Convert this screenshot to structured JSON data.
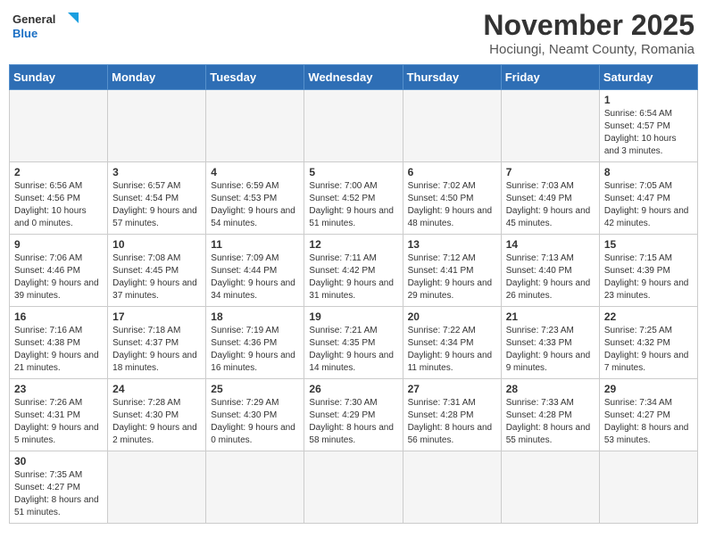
{
  "header": {
    "logo_general": "General",
    "logo_blue": "Blue",
    "month_year": "November 2025",
    "location": "Hociungi, Neamt County, Romania"
  },
  "days_of_week": [
    "Sunday",
    "Monday",
    "Tuesday",
    "Wednesday",
    "Thursday",
    "Friday",
    "Saturday"
  ],
  "weeks": [
    [
      {
        "day": "",
        "empty": true
      },
      {
        "day": "",
        "empty": true
      },
      {
        "day": "",
        "empty": true
      },
      {
        "day": "",
        "empty": true
      },
      {
        "day": "",
        "empty": true
      },
      {
        "day": "",
        "empty": true
      },
      {
        "day": "1",
        "info": "Sunrise: 6:54 AM\nSunset: 4:57 PM\nDaylight: 10 hours and 3 minutes."
      }
    ],
    [
      {
        "day": "2",
        "info": "Sunrise: 6:56 AM\nSunset: 4:56 PM\nDaylight: 10 hours and 0 minutes."
      },
      {
        "day": "3",
        "info": "Sunrise: 6:57 AM\nSunset: 4:54 PM\nDaylight: 9 hours and 57 minutes."
      },
      {
        "day": "4",
        "info": "Sunrise: 6:59 AM\nSunset: 4:53 PM\nDaylight: 9 hours and 54 minutes."
      },
      {
        "day": "5",
        "info": "Sunrise: 7:00 AM\nSunset: 4:52 PM\nDaylight: 9 hours and 51 minutes."
      },
      {
        "day": "6",
        "info": "Sunrise: 7:02 AM\nSunset: 4:50 PM\nDaylight: 9 hours and 48 minutes."
      },
      {
        "day": "7",
        "info": "Sunrise: 7:03 AM\nSunset: 4:49 PM\nDaylight: 9 hours and 45 minutes."
      },
      {
        "day": "8",
        "info": "Sunrise: 7:05 AM\nSunset: 4:47 PM\nDaylight: 9 hours and 42 minutes."
      }
    ],
    [
      {
        "day": "9",
        "info": "Sunrise: 7:06 AM\nSunset: 4:46 PM\nDaylight: 9 hours and 39 minutes."
      },
      {
        "day": "10",
        "info": "Sunrise: 7:08 AM\nSunset: 4:45 PM\nDaylight: 9 hours and 37 minutes."
      },
      {
        "day": "11",
        "info": "Sunrise: 7:09 AM\nSunset: 4:44 PM\nDaylight: 9 hours and 34 minutes."
      },
      {
        "day": "12",
        "info": "Sunrise: 7:11 AM\nSunset: 4:42 PM\nDaylight: 9 hours and 31 minutes."
      },
      {
        "day": "13",
        "info": "Sunrise: 7:12 AM\nSunset: 4:41 PM\nDaylight: 9 hours and 29 minutes."
      },
      {
        "day": "14",
        "info": "Sunrise: 7:13 AM\nSunset: 4:40 PM\nDaylight: 9 hours and 26 minutes."
      },
      {
        "day": "15",
        "info": "Sunrise: 7:15 AM\nSunset: 4:39 PM\nDaylight: 9 hours and 23 minutes."
      }
    ],
    [
      {
        "day": "16",
        "info": "Sunrise: 7:16 AM\nSunset: 4:38 PM\nDaylight: 9 hours and 21 minutes."
      },
      {
        "day": "17",
        "info": "Sunrise: 7:18 AM\nSunset: 4:37 PM\nDaylight: 9 hours and 18 minutes."
      },
      {
        "day": "18",
        "info": "Sunrise: 7:19 AM\nSunset: 4:36 PM\nDaylight: 9 hours and 16 minutes."
      },
      {
        "day": "19",
        "info": "Sunrise: 7:21 AM\nSunset: 4:35 PM\nDaylight: 9 hours and 14 minutes."
      },
      {
        "day": "20",
        "info": "Sunrise: 7:22 AM\nSunset: 4:34 PM\nDaylight: 9 hours and 11 minutes."
      },
      {
        "day": "21",
        "info": "Sunrise: 7:23 AM\nSunset: 4:33 PM\nDaylight: 9 hours and 9 minutes."
      },
      {
        "day": "22",
        "info": "Sunrise: 7:25 AM\nSunset: 4:32 PM\nDaylight: 9 hours and 7 minutes."
      }
    ],
    [
      {
        "day": "23",
        "info": "Sunrise: 7:26 AM\nSunset: 4:31 PM\nDaylight: 9 hours and 5 minutes."
      },
      {
        "day": "24",
        "info": "Sunrise: 7:28 AM\nSunset: 4:30 PM\nDaylight: 9 hours and 2 minutes."
      },
      {
        "day": "25",
        "info": "Sunrise: 7:29 AM\nSunset: 4:30 PM\nDaylight: 9 hours and 0 minutes."
      },
      {
        "day": "26",
        "info": "Sunrise: 7:30 AM\nSunset: 4:29 PM\nDaylight: 8 hours and 58 minutes."
      },
      {
        "day": "27",
        "info": "Sunrise: 7:31 AM\nSunset: 4:28 PM\nDaylight: 8 hours and 56 minutes."
      },
      {
        "day": "28",
        "info": "Sunrise: 7:33 AM\nSunset: 4:28 PM\nDaylight: 8 hours and 55 minutes."
      },
      {
        "day": "29",
        "info": "Sunrise: 7:34 AM\nSunset: 4:27 PM\nDaylight: 8 hours and 53 minutes."
      }
    ],
    [
      {
        "day": "30",
        "info": "Sunrise: 7:35 AM\nSunset: 4:27 PM\nDaylight: 8 hours and 51 minutes."
      },
      {
        "day": "",
        "empty": true
      },
      {
        "day": "",
        "empty": true
      },
      {
        "day": "",
        "empty": true
      },
      {
        "day": "",
        "empty": true
      },
      {
        "day": "",
        "empty": true
      },
      {
        "day": "",
        "empty": true
      }
    ]
  ]
}
